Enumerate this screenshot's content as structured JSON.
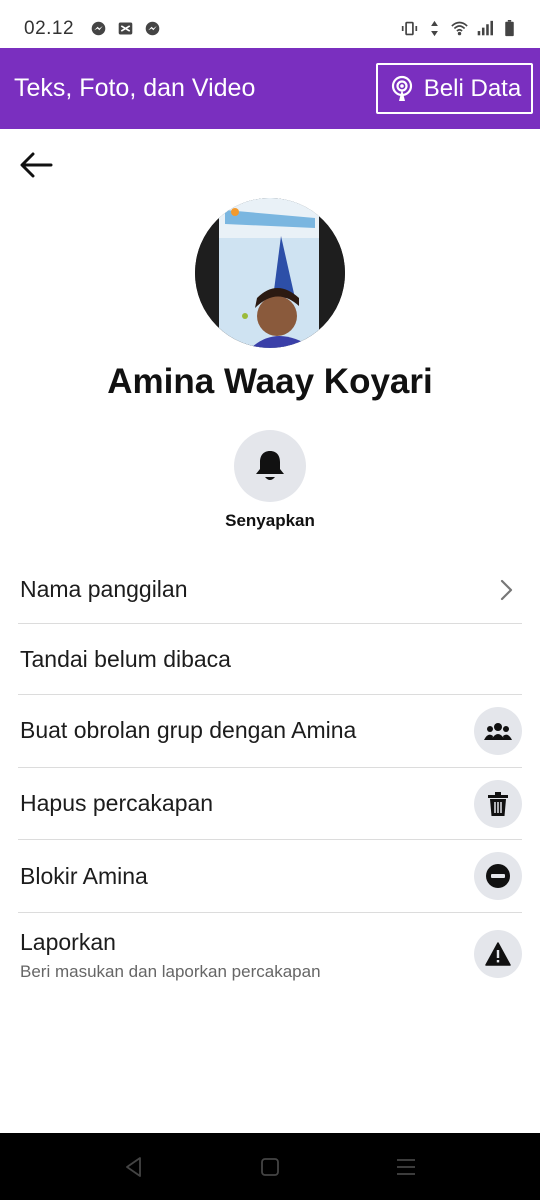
{
  "status_bar": {
    "time": "02.12",
    "left_icons": [
      "messenger-icon",
      "gallery-icon",
      "messenger-icon"
    ],
    "right_icons": [
      "vibrate-icon",
      "data-arrows-icon",
      "wifi-icon",
      "signal-icon",
      "battery-icon"
    ]
  },
  "banner": {
    "title": "Teks, Foto, dan Video",
    "buy_label": "Beli Data",
    "background_color": "#7a2fbf"
  },
  "profile": {
    "name": "Amina Waay Koyari",
    "mute_label": "Senyapkan"
  },
  "menu": {
    "nickname": "Nama panggilan",
    "mark_unread": "Tandai belum dibaca",
    "group_chat": "Buat obrolan grup dengan Amina",
    "delete_chat": "Hapus percakapan",
    "block": "Blokir Amina",
    "report": "Laporkan",
    "report_sub": "Beri masukan dan laporkan percakapan"
  },
  "icons": {
    "back": "arrow-left-icon",
    "mute": "bell-icon",
    "nickname": "chevron-right-icon",
    "group_chat": "group-icon",
    "delete_chat": "trash-icon",
    "block": "block-icon",
    "report": "warning-icon",
    "buy": "podcast-icon"
  }
}
